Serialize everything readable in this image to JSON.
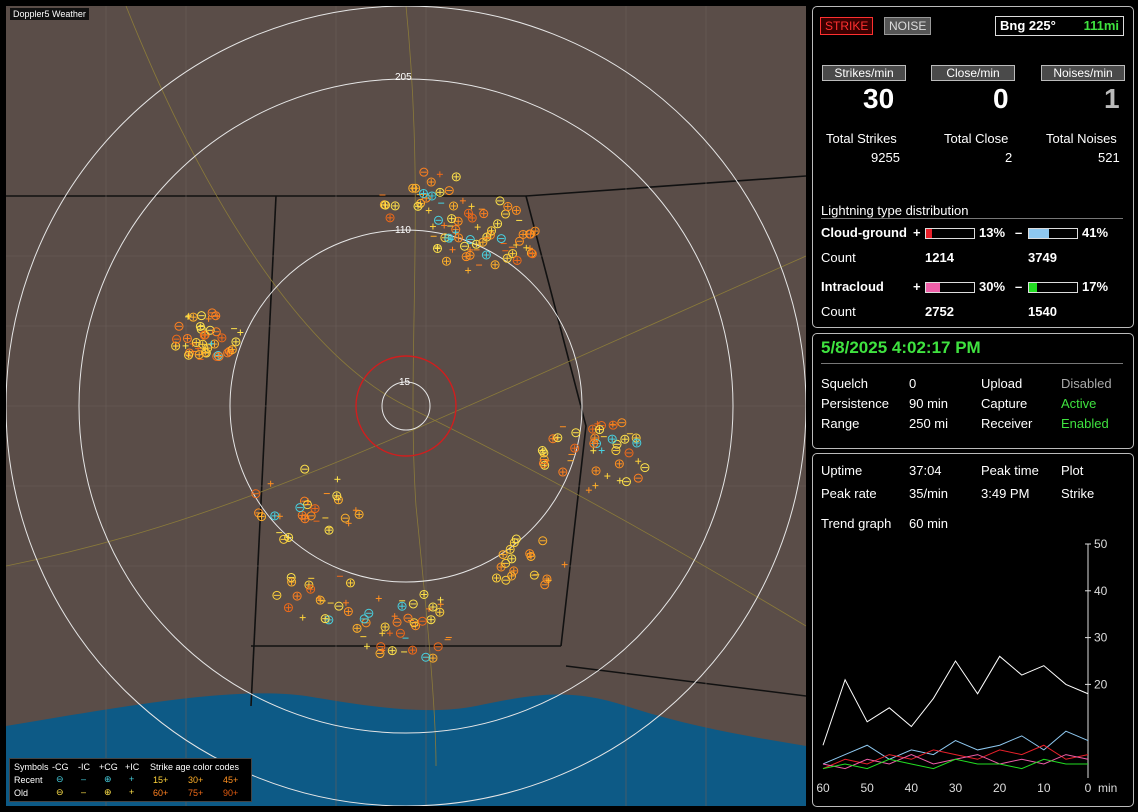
{
  "map": {
    "title": "Doppler5 Weather",
    "ring_labels": [
      "205",
      "110",
      "15"
    ],
    "legend": {
      "symbols_label": "Symbols",
      "cols": [
        "-CG",
        "-IC",
        "+CG",
        "+IC"
      ],
      "recent_label": "Recent",
      "old_label": "Old",
      "age_title": "Strike age color codes",
      "age_row1": [
        "15+",
        "30+",
        "45+"
      ],
      "age_row2": [
        "60+",
        "75+",
        "90+"
      ]
    }
  },
  "top": {
    "strike_button": "STRIKE",
    "noise_button": "NOISE",
    "bearing": "Bng 225°",
    "distance": "111mi",
    "strikes_min_label": "Strikes/min",
    "close_min_label": "Close/min",
    "noises_min_label": "Noises/min",
    "strikes_min": "30",
    "close_min": "0",
    "noises_min": "1",
    "total_strikes_label": "Total Strikes",
    "total_close_label": "Total Close",
    "total_noises_label": "Total Noises",
    "total_strikes": "9255",
    "total_close": "2",
    "total_noises": "521",
    "dist_title": "Lightning type distribution",
    "cg_label": "Cloud-ground",
    "ic_label": "Intracloud",
    "count_label": "Count",
    "plus": "+",
    "minus": "–",
    "cg_pos_pct": "13%",
    "cg_neg_pct": "41%",
    "cg_pos_count": "1214",
    "cg_neg_count": "3749",
    "ic_pos_pct": "30%",
    "ic_neg_pct": "17%",
    "ic_pos_count": "2752",
    "ic_neg_count": "1540",
    "bar_levels": {
      "cg_pos": 13,
      "cg_neg": 41,
      "ic_pos": 30,
      "ic_neg": 17
    },
    "colors": {
      "cg_pos": "#e8202a",
      "cg_neg": "#8ec8f0",
      "ic_pos": "#ee5fa8",
      "ic_neg": "#22dd22"
    }
  },
  "status": {
    "datetime": "5/8/2025 4:02:17 PM",
    "squelch_label": "Squelch",
    "squelch": "0",
    "persistence_label": "Persistence",
    "persistence": "90 min",
    "range_label": "Range",
    "range": "250 mi",
    "upload_label": "Upload",
    "upload": "Disabled",
    "capture_label": "Capture",
    "capture": "Active",
    "receiver_label": "Receiver",
    "receiver": "Enabled"
  },
  "trend": {
    "uptime_label": "Uptime",
    "uptime": "37:04",
    "peak_time_label": "Peak time",
    "plot_label": "Plot",
    "peak_rate_label": "Peak rate",
    "peak_rate": "35/min",
    "peak_time": "3:49 PM",
    "plot": "Strike",
    "trend_label": "Trend graph",
    "trend_value": "60 min",
    "y_ticks": [
      "50",
      "40",
      "30",
      "20"
    ],
    "x_ticks": [
      "60",
      "50",
      "40",
      "30",
      "20",
      "10",
      "0"
    ],
    "x_unit": "min"
  },
  "chart_data": {
    "type": "line",
    "x": [
      60,
      55,
      50,
      45,
      40,
      35,
      30,
      25,
      20,
      15,
      10,
      5,
      0
    ],
    "ylim": [
      0,
      50
    ],
    "xlim": [
      60,
      0
    ],
    "series": [
      {
        "values": [
          7,
          21,
          12,
          15,
          11,
          17,
          25,
          18,
          26,
          22,
          24,
          20,
          18
        ],
        "color": "#ffffff"
      },
      {
        "values": [
          3,
          5,
          7,
          4,
          6,
          5,
          8,
          6,
          7,
          9,
          6,
          10,
          8
        ],
        "color": "#8ec8f0"
      },
      {
        "values": [
          2,
          4,
          3,
          5,
          4,
          6,
          5,
          4,
          6,
          5,
          7,
          4,
          5
        ],
        "color": "#e8202a"
      },
      {
        "values": [
          3,
          2,
          4,
          3,
          5,
          3,
          4,
          5,
          3,
          4,
          3,
          5,
          4
        ],
        "color": "#ee5fa8"
      },
      {
        "values": [
          2,
          3,
          2,
          4,
          3,
          2,
          4,
          3,
          3,
          2,
          4,
          3,
          3
        ],
        "color": "#22dd22"
      }
    ]
  }
}
